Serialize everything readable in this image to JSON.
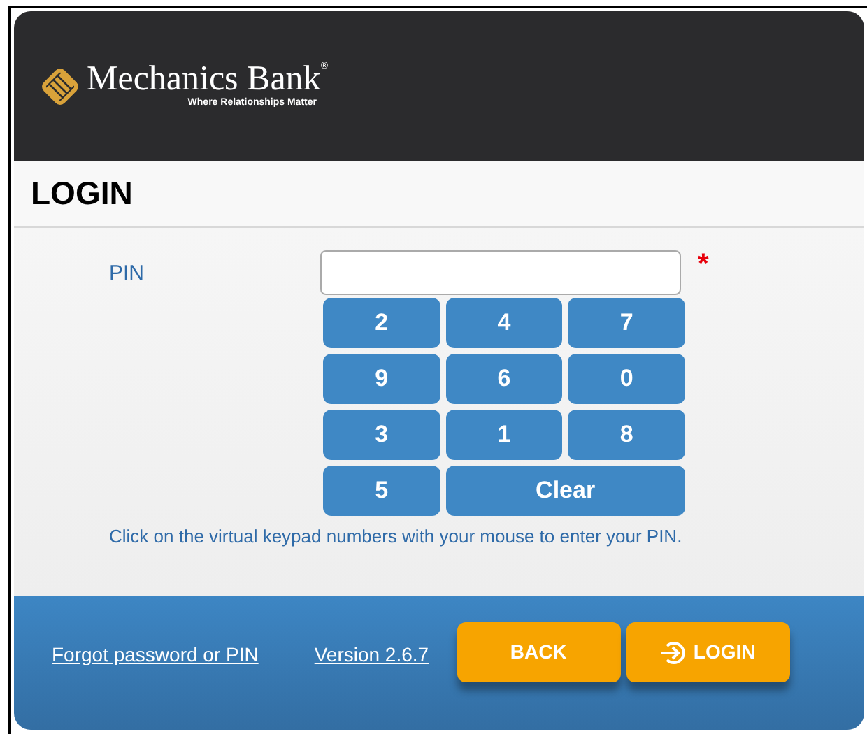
{
  "header": {
    "brand": "Mechanics Bank",
    "trademark": "®",
    "tagline": "Where Relationships Matter"
  },
  "section_title": "LOGIN",
  "pin_field": {
    "label": "PIN",
    "required_mark": "*"
  },
  "keypad": [
    {
      "label": "2",
      "kind": "digit"
    },
    {
      "label": "4",
      "kind": "digit"
    },
    {
      "label": "7",
      "kind": "digit"
    },
    {
      "label": "9",
      "kind": "digit"
    },
    {
      "label": "6",
      "kind": "digit"
    },
    {
      "label": "0",
      "kind": "digit"
    },
    {
      "label": "3",
      "kind": "digit"
    },
    {
      "label": "1",
      "kind": "digit"
    },
    {
      "label": "8",
      "kind": "digit"
    },
    {
      "label": "5",
      "kind": "digit"
    },
    {
      "label": "Clear",
      "kind": "clear"
    }
  ],
  "instructions": "Click on the virtual keypad numbers with your mouse to enter your PIN.",
  "footer": {
    "links": [
      "Forgot password or PIN",
      "Version 2.6.7"
    ],
    "buttons": [
      {
        "label": "BACK",
        "kind": "back"
      },
      {
        "label": "LOGIN",
        "kind": "login"
      }
    ]
  }
}
